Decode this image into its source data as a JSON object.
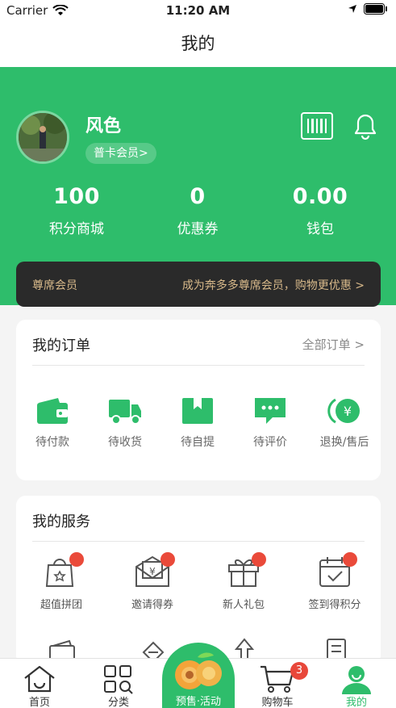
{
  "status_bar": {
    "carrier": "Carrier",
    "time": "11:20 AM"
  },
  "nav": {
    "title": "我的"
  },
  "profile": {
    "username": "风色",
    "member_level": "普卡会员>"
  },
  "stats": [
    {
      "value": "100",
      "label": "积分商城"
    },
    {
      "value": "0",
      "label": "优惠券"
    },
    {
      "value": "0.00",
      "label": "钱包"
    }
  ],
  "vip": {
    "left": "尊席会员",
    "right": "成为奔多多尊席会员，购物更优惠 >"
  },
  "orders": {
    "title": "我的订单",
    "all_link": "全部订单  >",
    "items": [
      {
        "label": "待付款",
        "icon": "wallet-icon"
      },
      {
        "label": "待收货",
        "icon": "truck-icon"
      },
      {
        "label": "待自提",
        "icon": "box-icon"
      },
      {
        "label": "待评价",
        "icon": "comment-icon"
      },
      {
        "label": "退换/售后",
        "icon": "refund-icon"
      }
    ]
  },
  "services": {
    "title": "我的服务",
    "items": [
      {
        "label": "超值拼团",
        "icon": "group-bag-icon"
      },
      {
        "label": "邀请得券",
        "icon": "invite-envelope-icon"
      },
      {
        "label": "新人礼包",
        "icon": "gift-icon"
      },
      {
        "label": "签到得积分",
        "icon": "calendar-check-icon"
      }
    ]
  },
  "tabbar": {
    "items": [
      {
        "label": "首页",
        "icon": "home-icon"
      },
      {
        "label": "分类",
        "icon": "category-icon"
      },
      {
        "label": "预售·活动",
        "icon": "presale-fruit-icon"
      },
      {
        "label": "购物车",
        "icon": "cart-icon"
      },
      {
        "label": "我的",
        "icon": "profile-icon"
      }
    ],
    "cart_badge": "3"
  },
  "colors": {
    "primary": "#2ebd6b",
    "vip_bg": "#2a2a2a",
    "vip_text": "#d8b98a",
    "badge": "#e8473a"
  }
}
